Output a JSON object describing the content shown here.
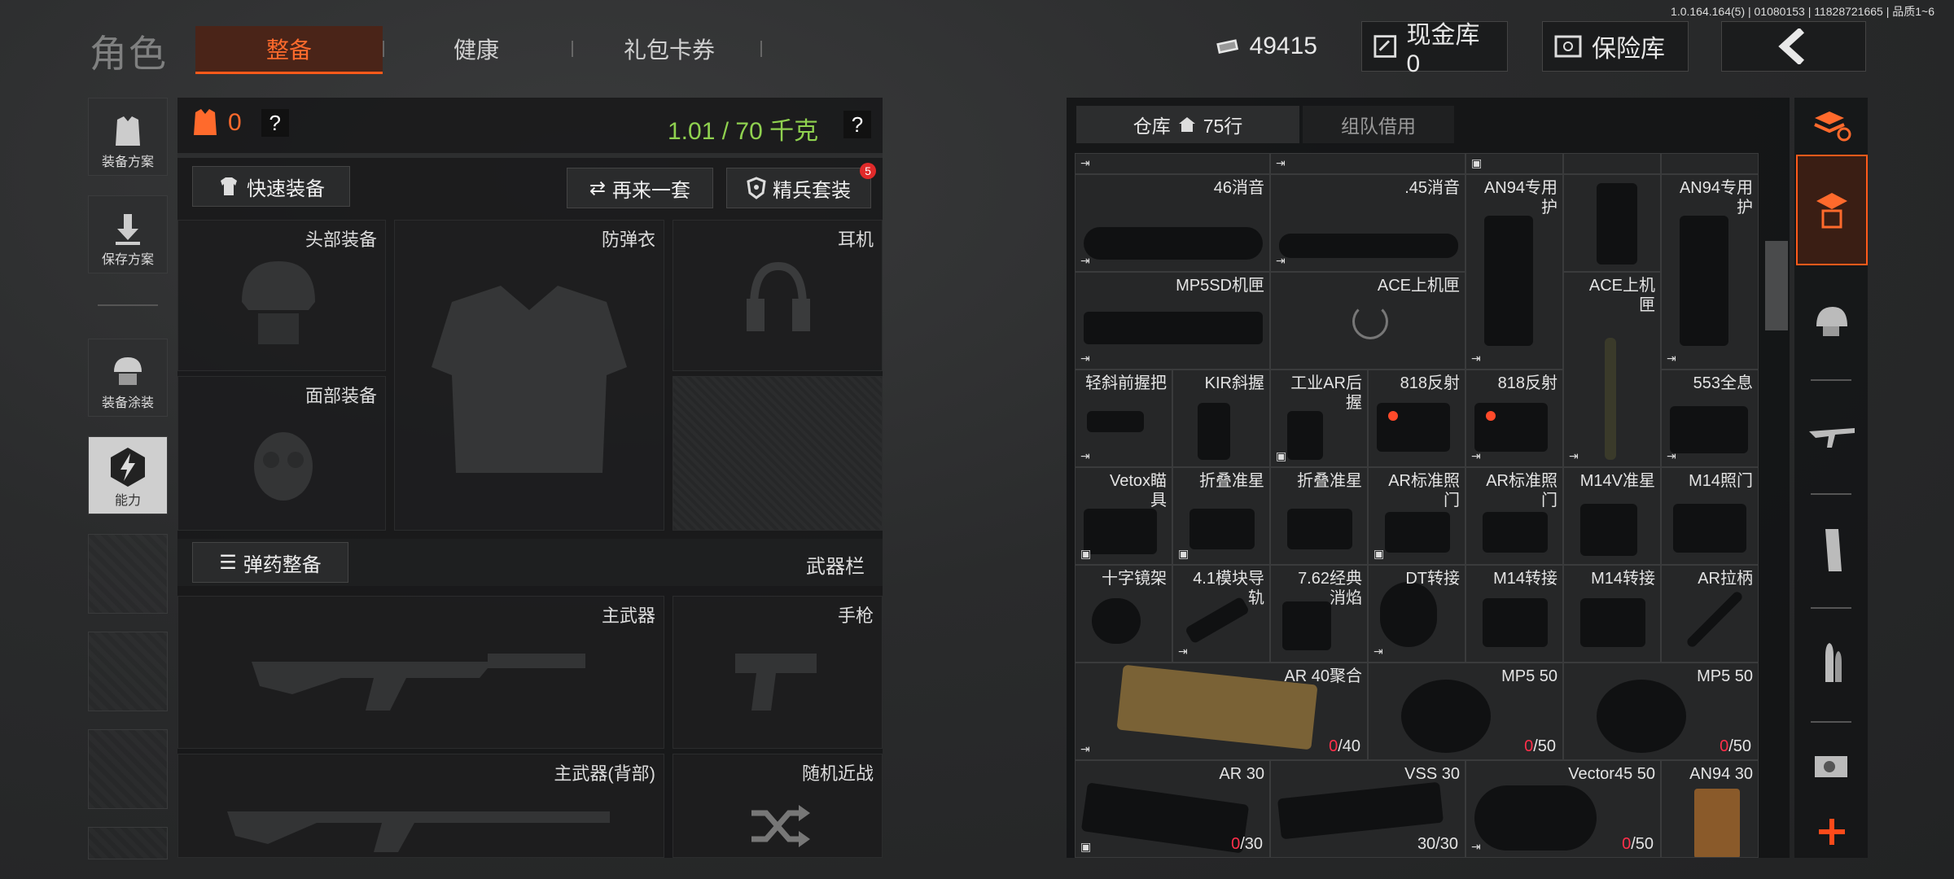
{
  "version_text": "1.0.164.164(5) | 01080153 | 11828721665 | 品质1~6",
  "header": {
    "title": "角色",
    "tabs": [
      {
        "label": "整备",
        "active": true
      },
      {
        "label": "健康",
        "active": false
      },
      {
        "label": "礼包卡券",
        "active": false
      }
    ],
    "currency": "49415",
    "cash_vault": "现金库 0",
    "insurance": "保险库",
    "back_icon": "chevron-left-icon"
  },
  "left_sidebar": {
    "items": [
      {
        "label": "装备方案",
        "icon": "vest-icon"
      },
      {
        "label": "保存方案",
        "icon": "download-icon"
      },
      {
        "label": "装备涂装",
        "icon": "helmet-paint-icon"
      },
      {
        "label": "能力",
        "icon": "lightning-icon"
      }
    ]
  },
  "loadout": {
    "armor_count": "0",
    "help": "?",
    "weight": "1.01 / 70 千克",
    "quick_equip": "快速装备",
    "again_set": "再来一套",
    "elite_set": "精兵套装",
    "elite_badge": "5",
    "slots": {
      "head": "头部装备",
      "vest": "防弹衣",
      "ear": "耳机",
      "face": "面部装备",
      "ammo": "弹药整备",
      "weapon_bar": "武器栏",
      "primary": "主武器",
      "pistol": "手枪",
      "primary_back": "主武器(背部)",
      "melee": "随机近战"
    }
  },
  "warehouse": {
    "tab_warehouse": "仓库",
    "rows": "75行",
    "tab_team": "组队借用",
    "items": [
      {
        "name": "46消音"
      },
      {
        "name": ".45消音"
      },
      {
        "name": "AN94专用护"
      },
      {
        "name": "AN94专用护"
      },
      {
        "name": "MP5SD机匣"
      },
      {
        "name": "ACE上机匣"
      },
      {
        "name": "ACE上机匣"
      },
      {
        "name": "轻斜前握把"
      },
      {
        "name": "KIR斜握"
      },
      {
        "name": "工业AR后握"
      },
      {
        "name": "818反射"
      },
      {
        "name": "818反射"
      },
      {
        "name": "553全息"
      },
      {
        "name": "Vetox瞄具"
      },
      {
        "name": "折叠准星"
      },
      {
        "name": "折叠准星"
      },
      {
        "name": "AR标准照门"
      },
      {
        "name": "AR标准照门"
      },
      {
        "name": "M14V准星"
      },
      {
        "name": "M14照门"
      },
      {
        "name": "十字镜架"
      },
      {
        "name": "4.1模块导轨"
      },
      {
        "name": "7.62经典消焰"
      },
      {
        "name": "DT转接"
      },
      {
        "name": "M14转接"
      },
      {
        "name": "M14转接"
      },
      {
        "name": "AR拉柄"
      },
      {
        "name": "AR 40聚合",
        "zero": "0",
        "cap": "/40"
      },
      {
        "name": "MP5 50",
        "zero": "0",
        "cap": "/50"
      },
      {
        "name": "MP5 50",
        "zero": "0",
        "cap": "/50"
      },
      {
        "name": "AR 30",
        "zero": "0",
        "cap": "/30"
      },
      {
        "name": "VSS 30",
        "full": "30/30"
      },
      {
        "name": "Vector45 50",
        "zero": "0",
        "cap": "/50"
      },
      {
        "name": "AN94 30"
      }
    ]
  },
  "right_bar": {
    "icons": [
      "stack-refresh-icon",
      "storage-icon",
      "helmet-icon",
      "rifle-icon",
      "magazine-icon",
      "bullet-icon",
      "sight-icon",
      "plus-icon"
    ]
  },
  "colors": {
    "accent": "#ff5a1a",
    "green": "#8fd14f",
    "red": "#ff2f4a"
  }
}
